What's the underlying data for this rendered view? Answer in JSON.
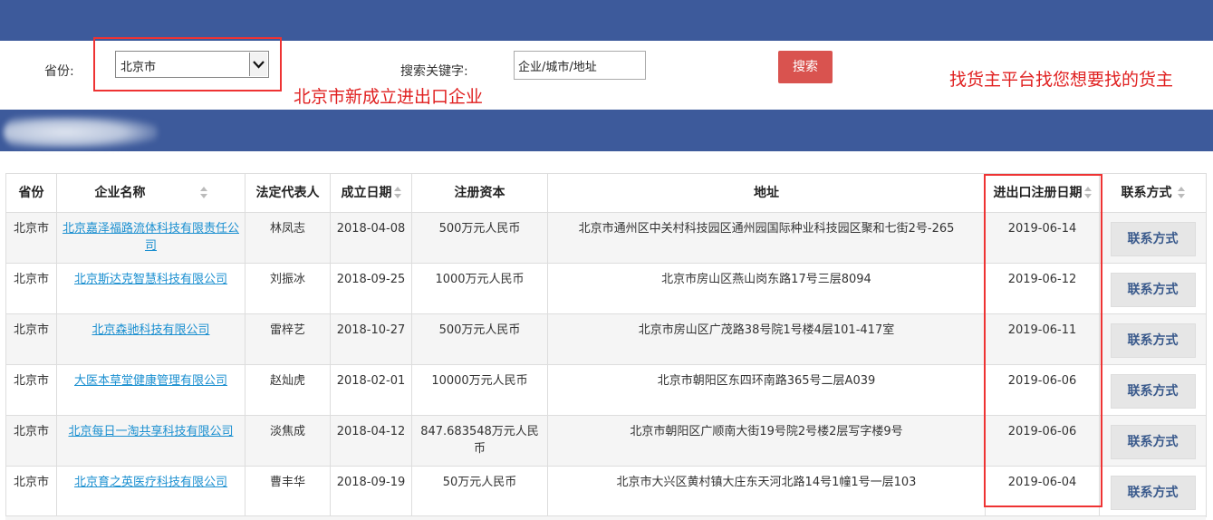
{
  "search": {
    "province_label": "省份:",
    "province_value": "北京市",
    "keyword_label": "搜索关键字:",
    "keyword_value": "企业/城市/地址",
    "search_button": "搜索"
  },
  "annotations": {
    "note_new_companies": "北京市新成立进出口企业",
    "note_platform": "找货主平台找您想要找的货主"
  },
  "table": {
    "headers": [
      "省份",
      "企业名称",
      "法定代表人",
      "成立日期",
      "注册资本",
      "地址",
      "进出口注册日期",
      "联系方式"
    ],
    "rows": [
      {
        "province": "北京市",
        "company": "北京嘉泽福路流体科技有限责任公司",
        "legal_rep": "林凤志",
        "founded": "2018-04-08",
        "capital": "500万元人民币",
        "address": "北京市通州区中关村科技园区通州园国际种业科技园区聚和七街2号-265",
        "ie_date": "2019-06-14",
        "contact": "联系方式"
      },
      {
        "province": "北京市",
        "company": "北京斯达克智慧科技有限公司",
        "legal_rep": "刘振冰",
        "founded": "2018-09-25",
        "capital": "1000万元人民币",
        "address": "北京市房山区燕山岗东路17号三层8094",
        "ie_date": "2019-06-12",
        "contact": "联系方式"
      },
      {
        "province": "北京市",
        "company": "北京森驰科技有限公司",
        "legal_rep": "雷梓艺",
        "founded": "2018-10-27",
        "capital": "500万元人民币",
        "address": "北京市房山区广茂路38号院1号楼4层101-417室",
        "ie_date": "2019-06-11",
        "contact": "联系方式"
      },
      {
        "province": "北京市",
        "company": "大医本草堂健康管理有限公司",
        "legal_rep": "赵灿虎",
        "founded": "2018-02-01",
        "capital": "10000万元人民币",
        "address": "北京市朝阳区东四环南路365号二层A039",
        "ie_date": "2019-06-06",
        "contact": "联系方式"
      },
      {
        "province": "北京市",
        "company": "北京每日一淘共享科技有限公司",
        "legal_rep": "淡焦成",
        "founded": "2018-04-12",
        "capital": "847.683548万元人民币",
        "address": "北京市朝阳区广顺南大街19号院2号楼2层写字楼9号",
        "ie_date": "2019-06-06",
        "contact": "联系方式"
      },
      {
        "province": "北京市",
        "company": "北京育之英医疗科技有限公司",
        "legal_rep": "曹丰华",
        "founded": "2018-09-19",
        "capital": "50万元人民币",
        "address": "北京市大兴区黄村镇大庄东天河北路14号1幢1号一层103",
        "ie_date": "2019-06-04",
        "contact": "联系方式"
      }
    ]
  }
}
